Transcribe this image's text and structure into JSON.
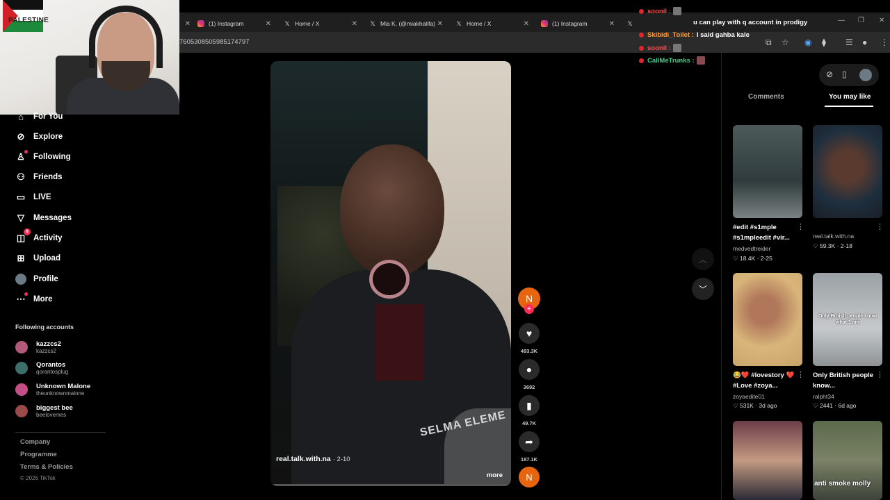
{
  "browser": {
    "tabs": [
      {
        "label": "(1) Instagram",
        "icon": "instagram-icon"
      },
      {
        "label": "Home / X",
        "icon": "x-icon"
      },
      {
        "label": "Mia K. (@miakhalifa)",
        "icon": "x-icon"
      },
      {
        "label": "Home / X",
        "icon": "x-icon"
      },
      {
        "label": "(1) Instagram",
        "icon": "instagram-icon"
      }
    ],
    "url_fragment": "7605308505985174797"
  },
  "webcam": {
    "sign_text": "PALESTINE"
  },
  "sidebar": {
    "items": [
      {
        "label": "For You",
        "icon": "home-icon"
      },
      {
        "label": "Explore",
        "icon": "compass-icon"
      },
      {
        "label": "Following",
        "icon": "user-follow-icon"
      },
      {
        "label": "Friends",
        "icon": "friends-icon"
      },
      {
        "label": "LIVE",
        "icon": "live-tv-icon"
      },
      {
        "label": "Messages",
        "icon": "paper-plane-icon"
      },
      {
        "label": "Activity",
        "icon": "bell-icon",
        "badge": "8"
      },
      {
        "label": "Upload",
        "icon": "plus-square-icon"
      },
      {
        "label": "Profile",
        "icon": "avatar"
      },
      {
        "label": "More",
        "icon": "more-dots-icon"
      }
    ],
    "following_title": "Following accounts",
    "following": [
      {
        "name": "kazzcs2",
        "handle": "kazzcs2"
      },
      {
        "name": "Qorantos",
        "handle": "qorantosplug"
      },
      {
        "name": "Unknown Malone",
        "handle": "theunknownmalone"
      },
      {
        "name": "biggest bee",
        "handle": "beelovemes"
      }
    ],
    "footer": [
      "Company",
      "Programme",
      "Terms & Policies"
    ],
    "copyright": "© 2026 TikTok"
  },
  "video": {
    "author": "real.talk.with.na",
    "date": "· 2-10",
    "more_label": "more",
    "hoodie_text": "SELMA ELEME",
    "creator_initial": "N",
    "likes": "493.3K",
    "comments": "3692",
    "saves": "49.7K",
    "shares": "187.1K"
  },
  "right_panel": {
    "tabs": [
      "Comments",
      "You may like"
    ],
    "active_tab": "You may like",
    "tiles": [
      {
        "title": "#edit #s1mple #s1mpleedit #vir...",
        "user": "medvedtreider",
        "likes": "18.4K",
        "date": "2-25"
      },
      {
        "title": "",
        "user": "real.talk.with.na",
        "likes": "59.3K",
        "date": "2-18"
      },
      {
        "title": "😂❤️ #lovestory ❤️ #Love #zoya...",
        "user": "zoyaedite01",
        "likes": "531K",
        "date": "3d ago"
      },
      {
        "title": "Only British people know...",
        "user": "ralpht34",
        "likes": "2441",
        "date": "6d ago",
        "overlay": "Only British people know what 1 am"
      },
      {
        "title": "",
        "user": "",
        "likes": "",
        "date": ""
      },
      {
        "title": "",
        "user": "",
        "likes": "",
        "date": "",
        "overlay": "anti smoke molly"
      }
    ]
  },
  "chat": [
    {
      "user": "soonil :",
      "color": "#ff4d4d",
      "msg": ""
    },
    {
      "user": "u can play with q account in prodigy",
      "color": "#ffffff",
      "msg": ""
    },
    {
      "user": "Skibidi_Toilet :",
      "color": "#ff9a3c",
      "msg": "I said gahba kale"
    },
    {
      "user": "soonil :",
      "color": "#ff4d4d",
      "msg": ""
    },
    {
      "user": "CallMeTrunks :",
      "color": "#3fd08a",
      "msg": ""
    }
  ],
  "colors": {
    "accent": "#fe2c55",
    "creator": "#e8650f",
    "background": "#000000"
  }
}
